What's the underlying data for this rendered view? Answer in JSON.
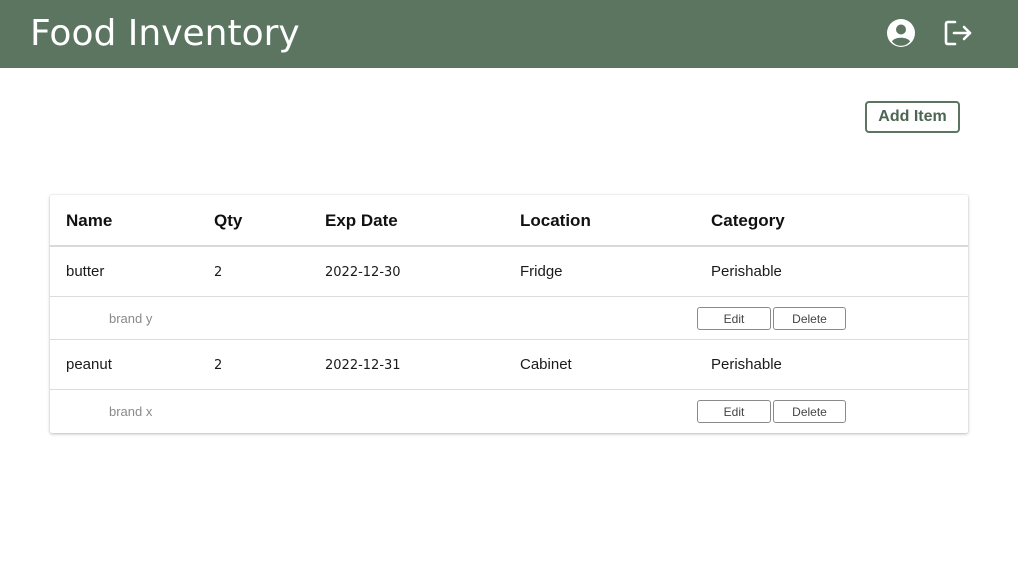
{
  "header": {
    "title": "Food Inventory",
    "account_icon": "account-circle-icon",
    "logout_icon": "logout-icon"
  },
  "toolbar": {
    "add_item_label": "Add Item"
  },
  "table": {
    "columns": {
      "name": "Name",
      "qty": "Qty",
      "exp_date": "Exp Date",
      "location": "Location",
      "category": "Category"
    },
    "rows": [
      {
        "name": "butter",
        "qty": "2",
        "exp_date": "2022-12-30",
        "location": "Fridge",
        "category": "Perishable",
        "brand": "brand y",
        "edit_label": "Edit",
        "delete_label": "Delete"
      },
      {
        "name": "peanut",
        "qty": "2",
        "exp_date": "2022-12-31",
        "location": "Cabinet",
        "category": "Perishable",
        "brand": "brand x",
        "edit_label": "Edit",
        "delete_label": "Delete"
      }
    ]
  },
  "colors": {
    "header_bg": "#5b7561",
    "accent": "#4d6653"
  }
}
